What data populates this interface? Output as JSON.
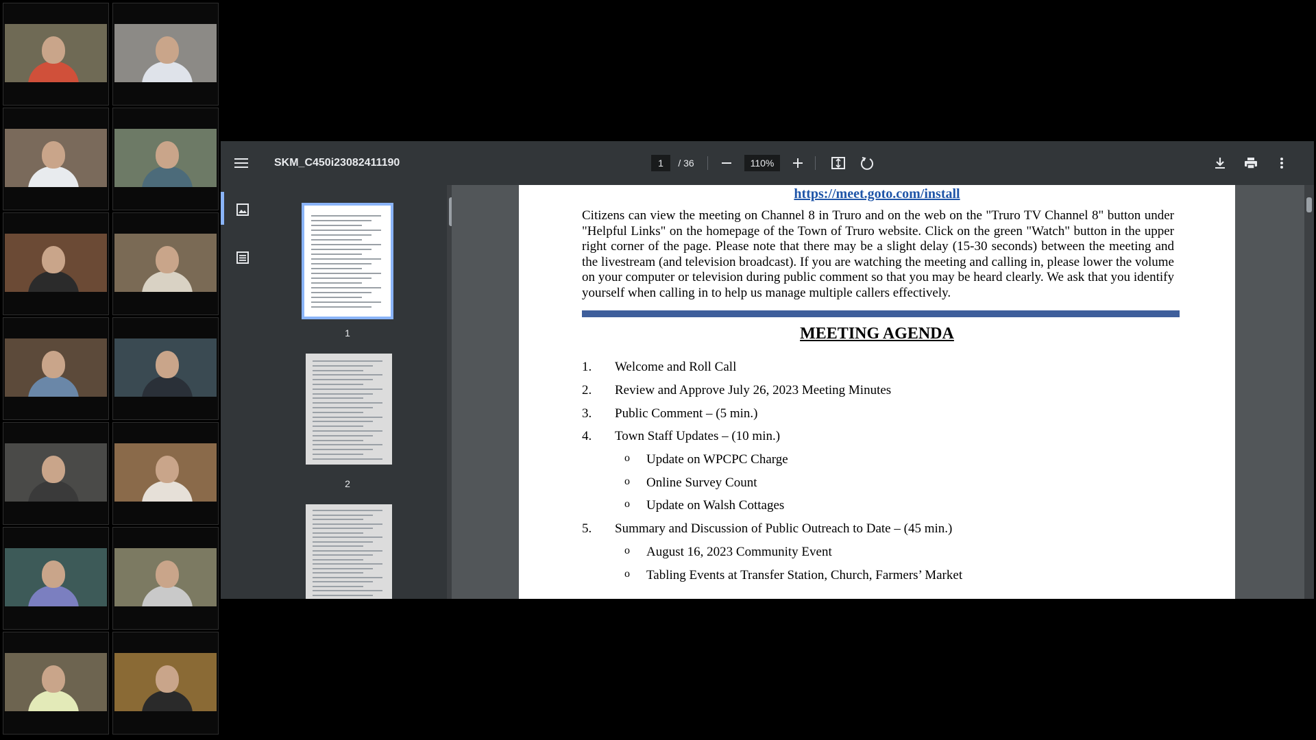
{
  "gallery": {
    "participants": [
      {
        "name": "participant-1",
        "bg": "#6f6a55",
        "shirt": "#d0503a"
      },
      {
        "name": "participant-2",
        "bg": "#8c8a86",
        "shirt": "#dfe3ea"
      },
      {
        "name": "participant-3",
        "bg": "#7a6a5b",
        "shirt": "#e8ebee"
      },
      {
        "name": "participant-4",
        "bg": "#6d7a66",
        "shirt": "#4c6b7a"
      },
      {
        "name": "participant-5",
        "bg": "#6b4a35",
        "shirt": "#2b2b2b"
      },
      {
        "name": "participant-6",
        "bg": "#7a6a55",
        "shirt": "#d9d2c4"
      },
      {
        "name": "participant-7",
        "bg": "#5c4a3a",
        "shirt": "#6a87a8"
      },
      {
        "name": "participant-8",
        "bg": "#3a4a52",
        "shirt": "#2a3038"
      },
      {
        "name": "participant-9",
        "bg": "#4a4a48",
        "shirt": "#3a3a3a"
      },
      {
        "name": "participant-10",
        "bg": "#8a6a4a",
        "shirt": "#e6e0d8"
      },
      {
        "name": "participant-11",
        "bg": "#3d5a58",
        "shirt": "#7b7fc0"
      },
      {
        "name": "participant-12",
        "bg": "#7c7a62",
        "shirt": "#c9c9c9"
      },
      {
        "name": "participant-13",
        "bg": "#6d6450",
        "shirt": "#e3eab8"
      },
      {
        "name": "participant-14",
        "bg": "#8a6a35",
        "shirt": "#2a2a2a"
      }
    ]
  },
  "viewer": {
    "filename": "SKM_C450i23082411190",
    "page_current": "1",
    "page_total": "/ 36",
    "zoom": "110%",
    "icons": {
      "menu": "menu-icon",
      "zoom_out": "minus-icon",
      "zoom_in": "plus-icon",
      "fit": "fit-page-icon",
      "rotate": "rotate-icon",
      "download": "download-icon",
      "print": "print-icon",
      "more": "more-vert-icon",
      "thumbnails": "thumbnails-icon",
      "outline": "outline-icon"
    },
    "thumbnails": [
      {
        "label": "1",
        "selected": true
      },
      {
        "label": "2",
        "selected": false
      }
    ],
    "colors": {
      "toolbar": "#323639",
      "accent": "#8ab4f8",
      "link": "#1f55a8",
      "rule": "#3e5e9b"
    }
  },
  "document": {
    "link": "https://meet.goto.com/install",
    "intro": "Citizens can view the meeting on Channel 8 in Truro and on the web on the \"Truro TV Channel 8\" button under \"Helpful Links\" on the homepage of the Town of Truro website. Click on the green \"Watch\" button in the upper right corner of the page.  Please note that there may be a slight delay (15-30 seconds) between the meeting and the livestream (and television broadcast). If you are watching the meeting and calling in, please lower the volume on your computer or television during public comment so that you may be heard clearly. We ask that you identify yourself when calling in to help us manage multiple callers effectively.",
    "heading": "MEETING AGENDA",
    "agenda": [
      {
        "num": "1.",
        "text": "Welcome and Roll Call"
      },
      {
        "num": "2.",
        "text": "Review and Approve July 26, 2023 Meeting Minutes"
      },
      {
        "num": "3.",
        "text": "Public Comment – (5 min.)"
      },
      {
        "num": "4.",
        "text": "Town Staff Updates – (10 min.)"
      },
      {
        "num": "5.",
        "text": "Summary and Discussion of Public Outreach to Date – (45 min.)"
      }
    ],
    "sub4": [
      "Update on WPCPC Charge",
      "Online Survey Count",
      "Update on Walsh Cottages"
    ],
    "sub5": [
      "August 16, 2023 Community Event",
      "Tabling Events at Transfer Station, Church, Farmers’ Market"
    ],
    "bullet": "o"
  }
}
